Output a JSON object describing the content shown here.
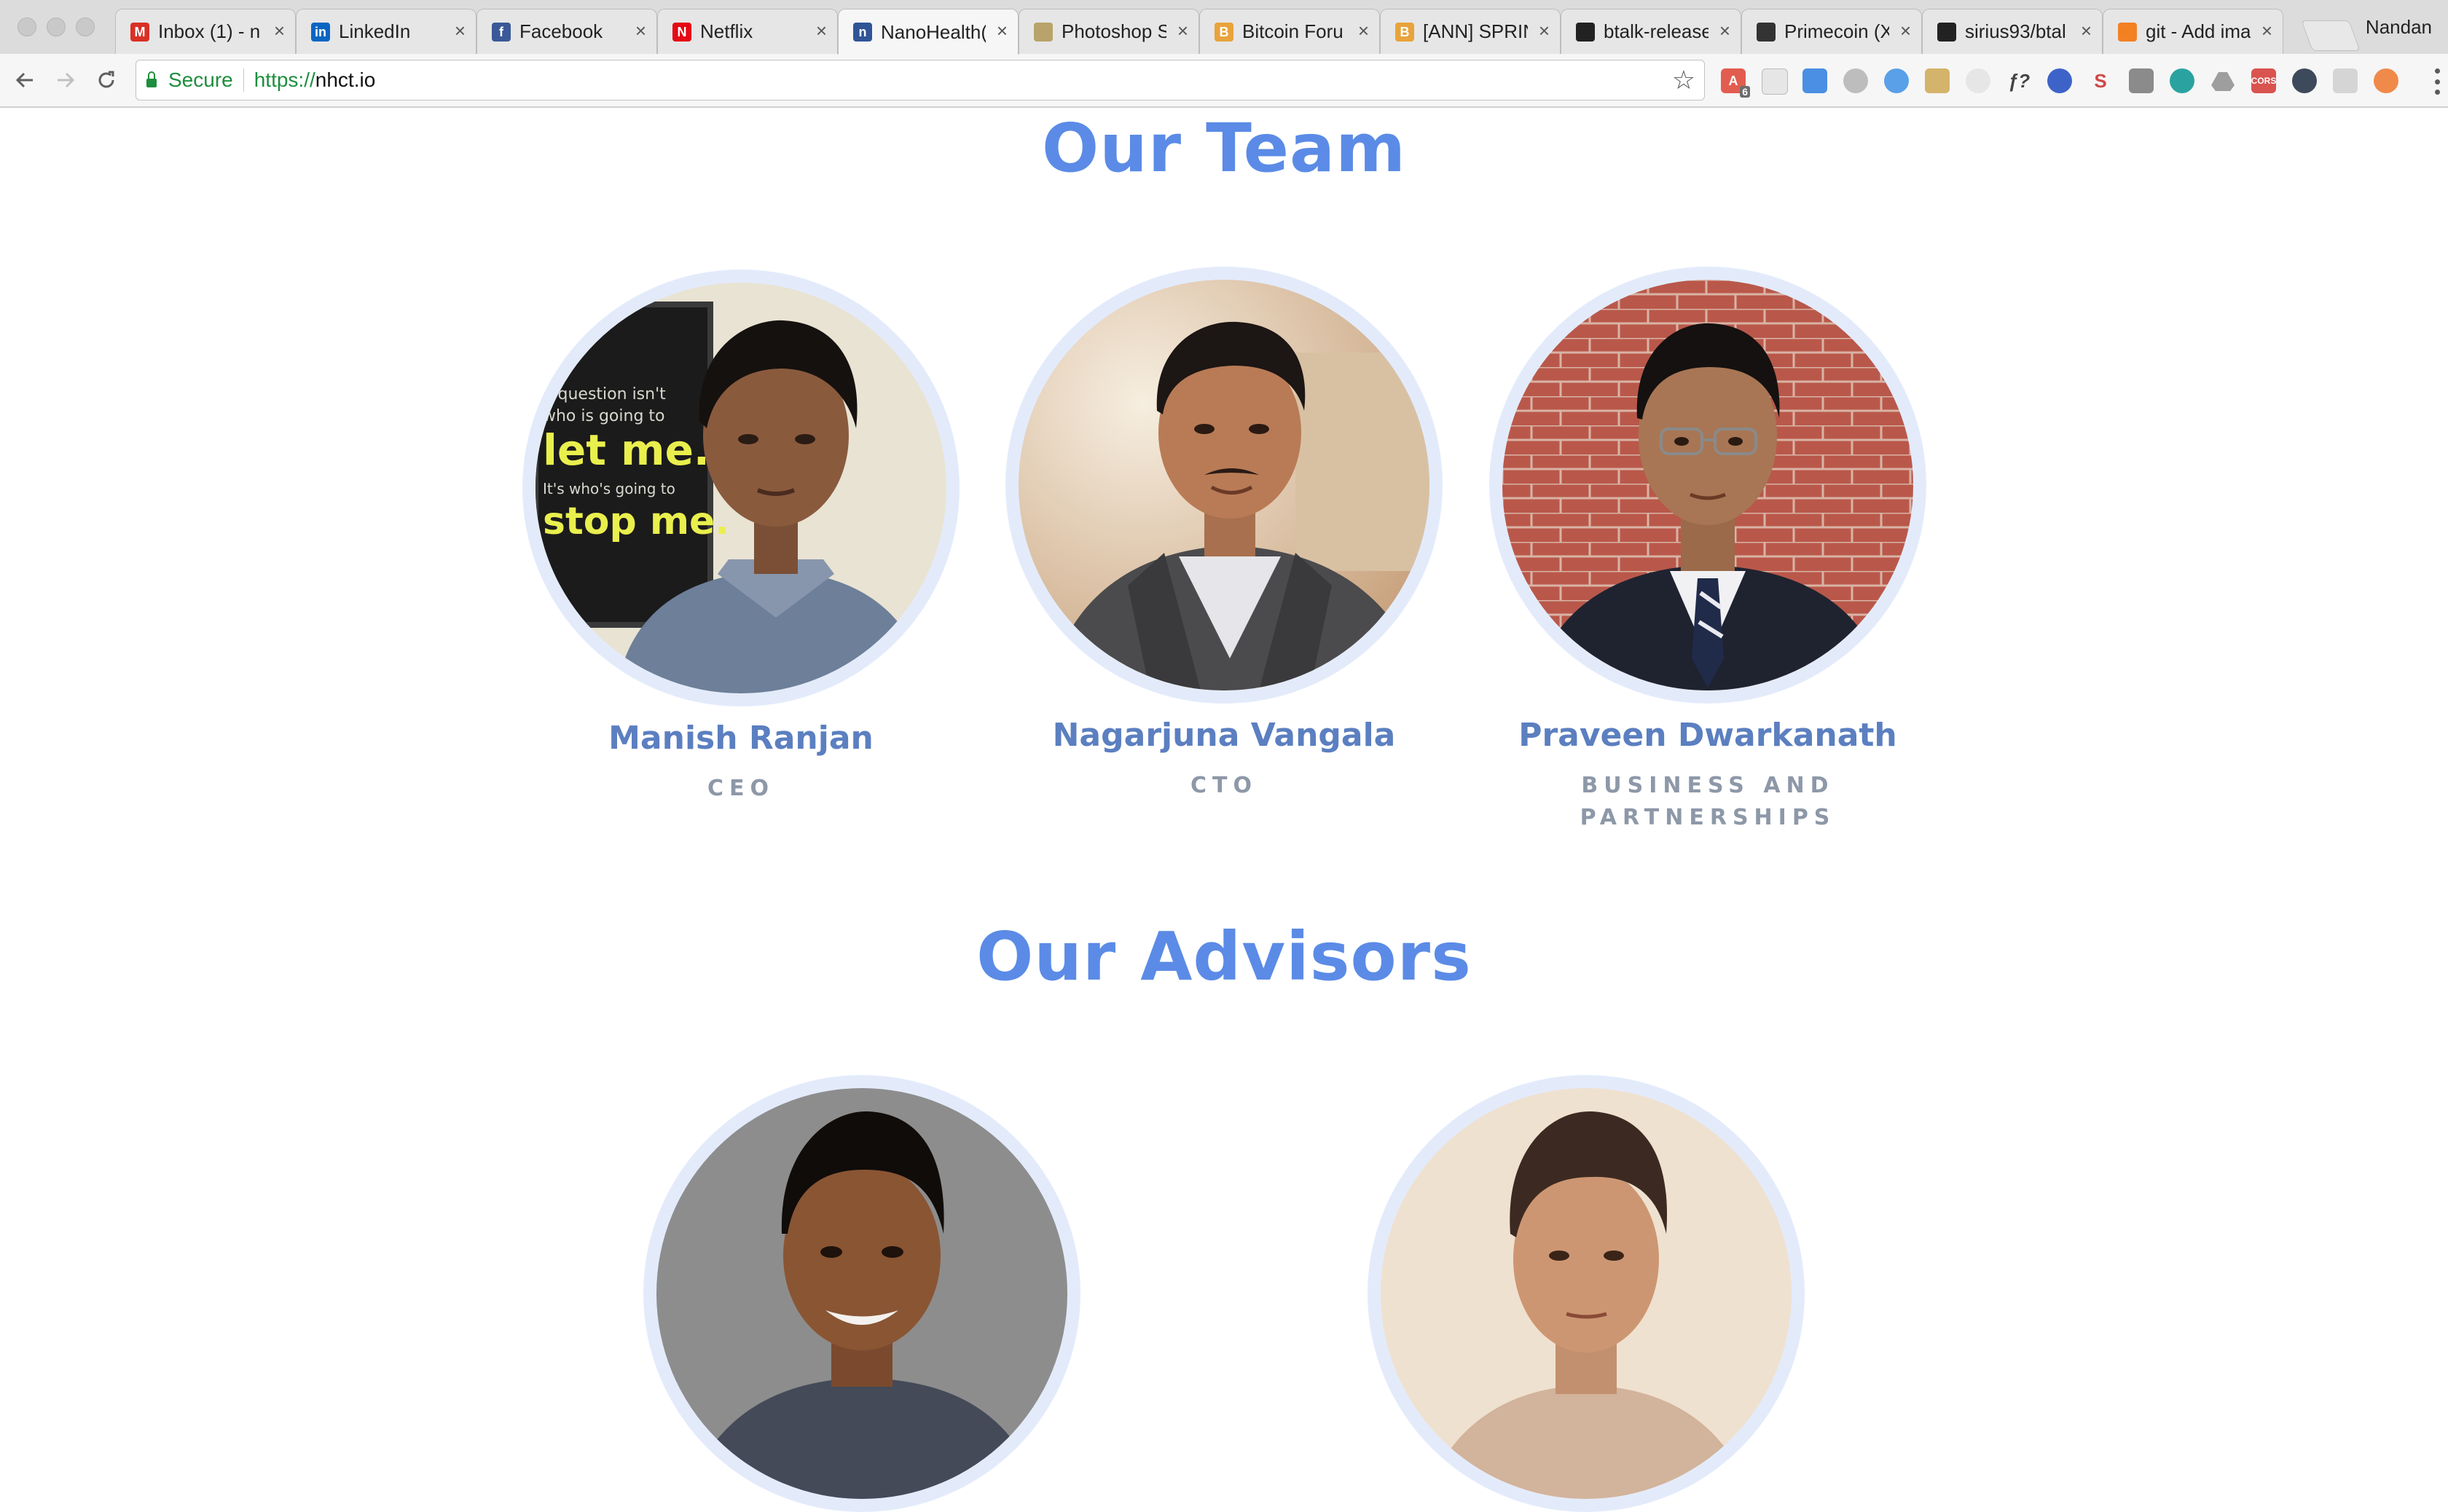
{
  "browser": {
    "profile_name": "Nandan",
    "tabs": [
      {
        "label": "Inbox (1) - n",
        "favicon": "gmail-icon",
        "color": "#d93025",
        "glyph": "M",
        "active": false
      },
      {
        "label": "LinkedIn",
        "favicon": "linkedin-icon",
        "color": "#0a66c2",
        "glyph": "in",
        "active": false
      },
      {
        "label": "Facebook",
        "favicon": "facebook-icon",
        "color": "#3b5998",
        "glyph": "f",
        "active": false
      },
      {
        "label": "Netflix",
        "favicon": "netflix-icon",
        "color": "#e50914",
        "glyph": "N",
        "active": false
      },
      {
        "label": "NanoHealth(",
        "favicon": "nanohealth-icon",
        "color": "#2f5597",
        "glyph": "n",
        "active": true
      },
      {
        "label": "Photoshop S",
        "favicon": "photoshop-icon",
        "color": "#b8a36a",
        "glyph": "",
        "active": false
      },
      {
        "label": "Bitcoin Foru",
        "favicon": "bitcoin-icon",
        "color": "#e8a33b",
        "glyph": "B",
        "active": false
      },
      {
        "label": "[ANN] SPRIN",
        "favicon": "bitcoin-icon",
        "color": "#e8a33b",
        "glyph": "B",
        "active": false
      },
      {
        "label": "btalk-release",
        "favicon": "github-icon",
        "color": "#222222",
        "glyph": "",
        "active": false
      },
      {
        "label": "Primecoin (X",
        "favicon": "primecoin-icon",
        "color": "#333333",
        "glyph": "",
        "active": false
      },
      {
        "label": "sirius93/btal",
        "favicon": "github-icon",
        "color": "#222222",
        "glyph": "",
        "active": false
      },
      {
        "label": "git - Add ima",
        "favicon": "stackoverflow-icon",
        "color": "#f48024",
        "glyph": "",
        "active": false
      }
    ],
    "tab_close_glyph": "×",
    "omnibox": {
      "secure_label": "Secure",
      "url_scheme": "https://",
      "url_host": "nhct.io"
    },
    "badge_count": "6"
  },
  "page": {
    "team_heading": "Our Team",
    "advisors_heading": "Our Advisors",
    "accent_color": "#5b8be6",
    "team": [
      {
        "name": "Manish Ranjan",
        "role": "CEO",
        "poster_lines": [
          "e question isn't",
          "who is going to",
          "let me.",
          "It's who's going to",
          "stop me."
        ]
      },
      {
        "name": "Nagarjuna Vangala",
        "role": "CTO"
      },
      {
        "name": "Praveen Dwarkanath",
        "role": "BUSINESS AND PARTNERSHIPS"
      }
    ],
    "advisors": [
      {
        "name": "",
        "role": ""
      },
      {
        "name": "",
        "role": ""
      }
    ]
  }
}
